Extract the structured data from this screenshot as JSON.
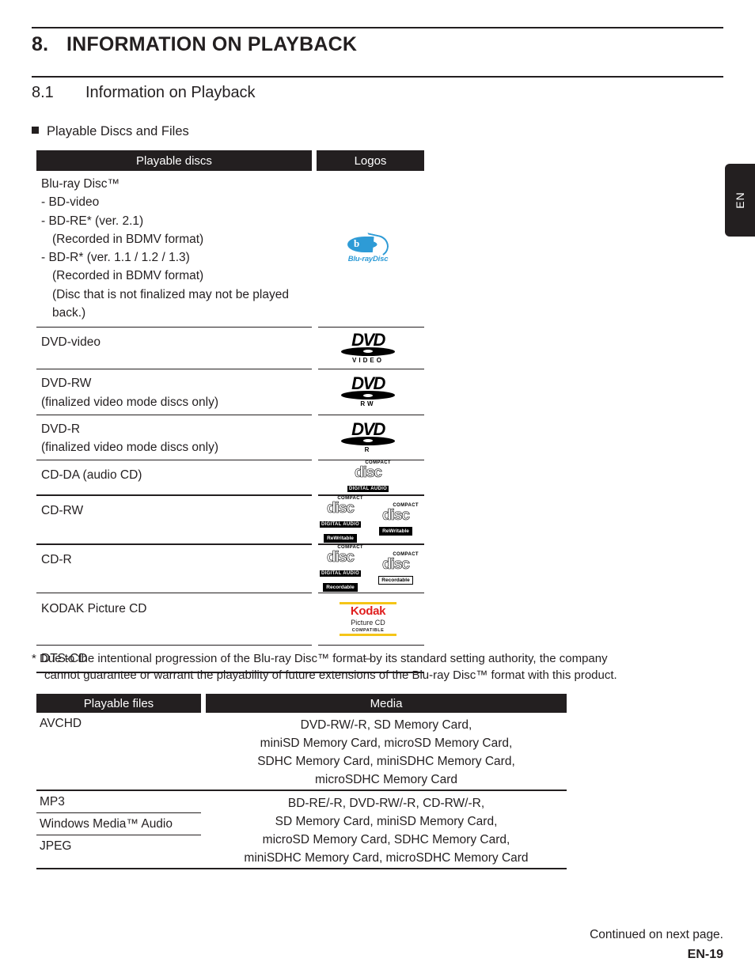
{
  "chapter": {
    "number": "8.",
    "title": "INFORMATION ON PLAYBACK"
  },
  "section": {
    "number": "8.1",
    "title": "Information on Playback"
  },
  "subhead": "Playable Discs and Files",
  "side_tab": {
    "label": "EN"
  },
  "table_discs": {
    "headers": {
      "col1": "Playable discs",
      "col2": "Logos"
    },
    "rows": [
      {
        "lines": [
          "Blu-ray Disc™",
          "- BD-video",
          "- BD-RE* (ver. 2.1)",
          "(Recorded in BDMV format)",
          "- BD-R* (ver. 1.1 / 1.2 / 1.3)",
          "(Recorded in BDMV format)",
          "(Disc that is not finalized may not be played",
          "back.)"
        ],
        "logo": "bluray-disc-logo"
      },
      {
        "lines": [
          "DVD-video"
        ],
        "logo": "dvd-video-logo"
      },
      {
        "lines": [
          "DVD-RW",
          "(finalized video mode discs only)"
        ],
        "logo": "dvd-rw-logo"
      },
      {
        "lines": [
          "DVD-R",
          "(finalized video mode discs only)"
        ],
        "logo": "dvd-r-logo"
      },
      {
        "lines": [
          "CD-DA (audio CD)"
        ],
        "logo": "compact-disc-digital-audio-logo"
      },
      {
        "lines": [
          "CD-RW"
        ],
        "logo": "compact-disc-rewritable-logo"
      },
      {
        "lines": [
          "CD-R"
        ],
        "logo": "compact-disc-recordable-logo"
      },
      {
        "lines": [
          "KODAK Picture CD"
        ],
        "logo": "kodak-picture-cd-logo"
      },
      {
        "lines": [
          "DTS-CD"
        ],
        "logo": "dash"
      }
    ]
  },
  "logos": {
    "bluray": {
      "word": "Blu-rayDisc",
      "letter": "b",
      "color": "#2E9BD6"
    },
    "dvd_video": {
      "word": "DVD",
      "sub": "VIDEO"
    },
    "dvd_rw": {
      "word": "DVD",
      "sub": "RW"
    },
    "dvd_r": {
      "word": "DVD",
      "sub": "R"
    },
    "cd": {
      "top": "COMPACT",
      "disc": "disc",
      "digital_audio": "DIGITAL AUDIO",
      "rewritable": "ReWritable",
      "recordable": "Recordable"
    },
    "kodak": {
      "name": "Kodak",
      "product": "Picture CD",
      "compatible": "COMPATIBLE",
      "red": "#E02020",
      "yellow": "#F5C518"
    },
    "dash": "–"
  },
  "footnote": {
    "marker": "*",
    "line1": "Due to the intentional progression of the Blu-ray Disc™ format by its standard setting authority, the company",
    "line2": "cannot guarantee or warrant the playability of future extensions of the Blu-ray Disc™ format with this product."
  },
  "table_files": {
    "headers": {
      "col1": "Playable files",
      "col2": "Media"
    },
    "group1": {
      "files": [
        "AVCHD"
      ],
      "media": [
        "DVD-RW/-R, SD Memory Card,",
        "miniSD Memory Card, microSD Memory Card,",
        "SDHC Memory Card, miniSDHC Memory Card,",
        "microSDHC Memory Card"
      ]
    },
    "group2": {
      "files": [
        "MP3",
        "Windows Media™ Audio",
        "JPEG"
      ],
      "media": [
        "BD-RE/-R, DVD-RW/-R, CD-RW/-R,",
        "SD Memory Card, miniSD Memory Card,",
        "microSD Memory Card, SDHC Memory Card,",
        "miniSDHC Memory Card, microSDHC Memory Card"
      ]
    }
  },
  "footer": {
    "continued": "Continued on next page.",
    "page": "EN-19"
  }
}
